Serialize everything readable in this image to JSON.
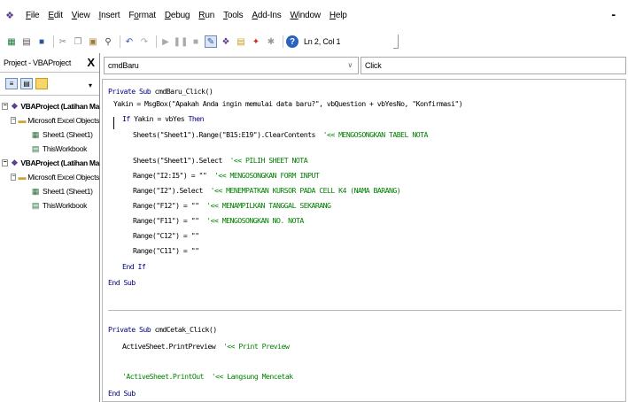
{
  "menubar": {
    "items": [
      {
        "acc": "F",
        "rest": "ile"
      },
      {
        "acc": "E",
        "rest": "dit"
      },
      {
        "acc": "V",
        "rest": "iew"
      },
      {
        "acc": "I",
        "rest": "nsert"
      },
      {
        "pre": "F",
        "acc": "o",
        "rest": "rmat"
      },
      {
        "acc": "D",
        "rest": "ebug"
      },
      {
        "acc": "R",
        "rest": "un"
      },
      {
        "acc": "T",
        "rest": "ools"
      },
      {
        "acc": "A",
        "rest": "dd-Ins"
      },
      {
        "acc": "W",
        "rest": "indow"
      },
      {
        "acc": "H",
        "rest": "elp"
      }
    ],
    "minimize": "-"
  },
  "toolbar": {
    "cursor_position": "Ln 2, Col 1"
  },
  "project": {
    "title": "Project - VBAProject",
    "close": "X",
    "tree": [
      {
        "exp": "−",
        "icon": "vbaproject-icon",
        "label": "VBAProject (Latihan Ma",
        "bold": true,
        "indent": 2
      },
      {
        "exp": "−",
        "icon": "folder-icon",
        "label": "Microsoft Excel Objects",
        "bold": false,
        "indent": 12
      },
      {
        "exp": "",
        "icon": "sheet-icon",
        "label": "Sheet1 (Sheet1)",
        "bold": false,
        "indent": 24
      },
      {
        "exp": "",
        "icon": "workbook-icon",
        "label": "ThisWorkbook",
        "bold": false,
        "indent": 24
      },
      {
        "exp": "−",
        "icon": "vbaproject-icon",
        "label": "VBAProject (Latihan Ma",
        "bold": true,
        "indent": 2
      },
      {
        "exp": "−",
        "icon": "folder-icon",
        "label": "Microsoft Excel Objects",
        "bold": false,
        "indent": 12
      },
      {
        "exp": "",
        "icon": "sheet-icon",
        "label": "Sheet1 (Sheet1)",
        "bold": false,
        "indent": 24
      },
      {
        "exp": "",
        "icon": "workbook-icon",
        "label": "ThisWorkbook",
        "bold": false,
        "indent": 24
      }
    ]
  },
  "code": {
    "object_combo": "cmdBaru",
    "procedure_combo": "Click",
    "lines": [
      [
        {
          "t": "Private Sub ",
          "c": "kw"
        },
        {
          "t": "cmdBaru_Click()"
        }
      ],
      [
        {
          "t": "Yakin = MsgBox(\"Apakah Anda ingin memulai data baru?\", vbQuestion + vbYesNo, \"Konfirmasi\")"
        }
      ],
      [
        {
          "t": "If ",
          "c": "kw"
        },
        {
          "t": "Yakin = vbYes "
        },
        {
          "t": "Then",
          "c": "kw"
        }
      ],
      [
        {
          "t": "Sheets(\"Sheet1\").Range(\"B15:E19\").ClearContents  "
        },
        {
          "t": "'<< MENGOSONGKAN TABEL NOTA",
          "c": "cmt"
        }
      ],
      [],
      [
        {
          "t": "Sheets(\"Sheet1\").Select  "
        },
        {
          "t": "'<< PILIH SHEET NOTA",
          "c": "cmt"
        }
      ],
      [
        {
          "t": "Range(\"I2:I5\") = \"\"  "
        },
        {
          "t": "'<< MENGOSONGKAN FORM INPUT",
          "c": "cmt"
        }
      ],
      [
        {
          "t": "Range(\"I2\").Select  "
        },
        {
          "t": "'<< MENEMPATKAN KURSOR PADA CELL K4 (NAMA BARANG)",
          "c": "cmt"
        }
      ],
      [
        {
          "t": "Range(\"F12\") = \"\"  "
        },
        {
          "t": "'<< MENAMPILKAN TANGGAL SEKARANG",
          "c": "cmt"
        }
      ],
      [
        {
          "t": "Range(\"F11\") = \"\"  "
        },
        {
          "t": "'<< MENGOSONGKAN NO. NOTA",
          "c": "cmt"
        }
      ],
      [
        {
          "t": "Range(\"C12\") = \"\""
        }
      ],
      [
        {
          "t": "Range(\"C11\") = \"\""
        }
      ],
      [
        {
          "t": "End If",
          "c": "kw"
        }
      ],
      [
        {
          "t": "End Sub",
          "c": "kw"
        }
      ],
      [
        {
          "t": "Private Sub ",
          "c": "kw"
        },
        {
          "t": "cmdCetak_Click()"
        }
      ],
      [
        {
          "t": "ActiveSheet.PrintPreview  "
        },
        {
          "t": "'<< Print Preview",
          "c": "cmt"
        }
      ],
      [],
      [
        {
          "t": "'ActiveSheet.PrintOut  '<< Langsung Mencetak",
          "c": "cmt"
        }
      ],
      [
        {
          "t": "End Sub",
          "c": "kw"
        }
      ]
    ]
  },
  "colors": {
    "keyword": "#00007f",
    "comment": "#007f00",
    "text": "#000000"
  }
}
